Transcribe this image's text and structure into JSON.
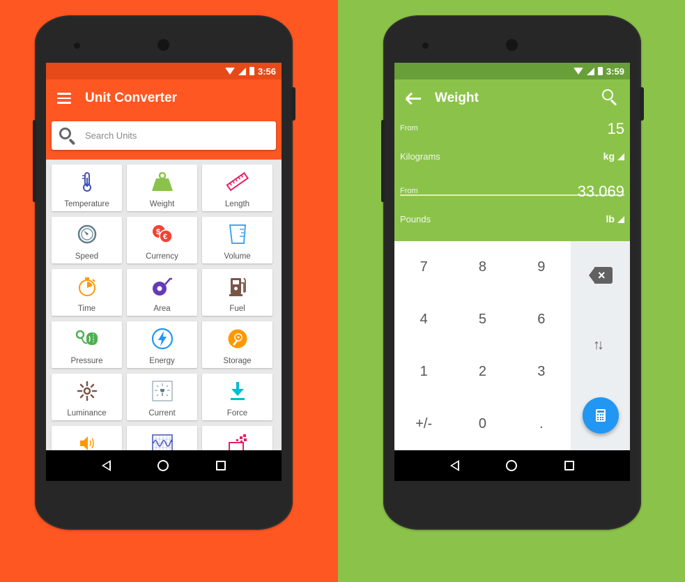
{
  "background": {
    "left_color": "#FF5722",
    "right_color": "#8BC34A"
  },
  "left_phone": {
    "status_bar": {
      "time": "3:56",
      "color": "#E64A19",
      "icons": [
        "wifi-icon",
        "signal-icon",
        "battery-icon"
      ]
    },
    "toolbar": {
      "title": "Unit Converter",
      "menu_icon": "hamburger-menu-icon",
      "color": "#FF5722"
    },
    "search": {
      "placeholder": "Search Units",
      "value": "",
      "icon": "search-icon"
    },
    "categories": [
      {
        "label": "Temperature",
        "icon": "thermometer-icon",
        "color": "#3F51B5"
      },
      {
        "label": "Weight",
        "icon": "weight-icon",
        "color": "#8BC34A"
      },
      {
        "label": "Length",
        "icon": "ruler-icon",
        "color": "#E91E63"
      },
      {
        "label": "Speed",
        "icon": "speedometer-icon",
        "color": "#607D8B"
      },
      {
        "label": "Currency",
        "icon": "currency-exchange-icon",
        "color": "#F44336"
      },
      {
        "label": "Volume",
        "icon": "measuring-cup-icon",
        "color": "#42A5F5"
      },
      {
        "label": "Time",
        "icon": "stopwatch-icon",
        "color": "#FF9800"
      },
      {
        "label": "Area",
        "icon": "tape-measure-icon",
        "color": "#673AB7"
      },
      {
        "label": "Fuel",
        "icon": "fuel-pump-icon",
        "color": "#795548"
      },
      {
        "label": "Pressure",
        "icon": "pressure-gauge-icon",
        "color": "#4CAF50"
      },
      {
        "label": "Energy",
        "icon": "lightning-icon",
        "color": "#2196F3"
      },
      {
        "label": "Storage",
        "icon": "disc-icon",
        "color": "#FF9800"
      },
      {
        "label": "Luminance",
        "icon": "sun-icon",
        "color": "#795548"
      },
      {
        "label": "Current",
        "icon": "plug-icon",
        "color": "#607D8B"
      },
      {
        "label": "Force",
        "icon": "download-arrow-icon",
        "color": "#00BCD4"
      },
      {
        "label": "",
        "icon": "speaker-icon",
        "color": "#FF9800"
      },
      {
        "label": "",
        "icon": "waveform-icon",
        "color": "#3F51B5"
      },
      {
        "label": "",
        "icon": "laptop-data-icon",
        "color": "#E91E63"
      }
    ],
    "nav": {
      "back": "back-icon",
      "home": "home-icon",
      "recents": "recents-icon"
    }
  },
  "right_phone": {
    "status_bar": {
      "time": "3:59",
      "color": "#689F38"
    },
    "toolbar": {
      "title": "Weight",
      "color": "#8BC34A"
    },
    "from": {
      "label": "From",
      "value": "15",
      "unit_name": "Kilograms",
      "unit_code": "kg"
    },
    "to": {
      "label": "From",
      "value": "33.069",
      "unit_name": "Pounds",
      "unit_code": "lb"
    },
    "keypad": {
      "keys": [
        "7",
        "8",
        "9",
        "4",
        "5",
        "6",
        "1",
        "2",
        "3",
        "+/-",
        "0",
        "."
      ],
      "backspace_icon": "backspace-icon",
      "swap_icon": "swap-units-icon",
      "swap_glyph": "↑↓",
      "backspace_glyph": "×",
      "fab_icon": "calculator-icon",
      "fab_color": "#2196F3"
    }
  }
}
